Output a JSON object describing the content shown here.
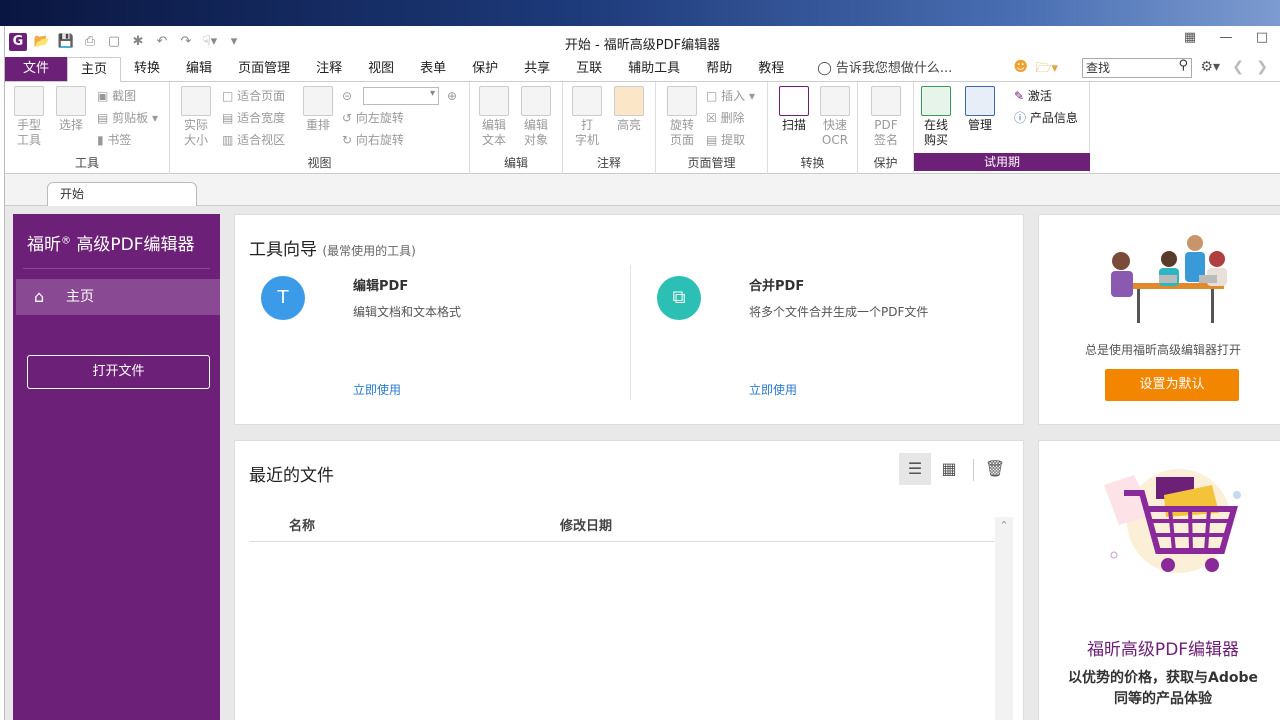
{
  "window": {
    "title": "开始 - 福昕高级PDF编辑器"
  },
  "menu_tabs": [
    "文件",
    "主页",
    "转换",
    "编辑",
    "页面管理",
    "注释",
    "视图",
    "表单",
    "保护",
    "共享",
    "互联",
    "辅助工具",
    "帮助",
    "教程"
  ],
  "tell_me": "告诉我您想做什么...",
  "search": {
    "placeholder": "查找"
  },
  "ribbon": {
    "tools": {
      "hand": "手型\n工具",
      "select": "选择",
      "snapshot": "截图",
      "clipboard": "剪贴板",
      "bookmark": "书签",
      "label": "工具"
    },
    "view": {
      "actual": "实际\n大小",
      "fit_page": "适合页面",
      "fit_width": "适合宽度",
      "fit_view": "适合视区",
      "reflow": "重排",
      "rotate_left": "向左旋转",
      "rotate_right": "向右旋转",
      "label": "视图"
    },
    "edit": {
      "edit_text": "编辑\n文本",
      "edit_object": "编辑\n对象",
      "label": "编辑"
    },
    "comment": {
      "typewriter": "打\n字机",
      "highlight": "高亮",
      "label": "注释"
    },
    "pages": {
      "rotate": "旋转\n页面",
      "insert": "插入",
      "delete": "删除",
      "extract": "提取",
      "label": "页面管理"
    },
    "convert": {
      "scan": "扫描",
      "ocr": "快速\nOCR",
      "label": "转换"
    },
    "protect": {
      "sign": "PDF\n签名",
      "label": "保护"
    },
    "trial": {
      "buy": "在线\n购买",
      "manage": "管理",
      "activate": "激活",
      "info": "产品信息",
      "label": "试用期"
    }
  },
  "doc_tab": "开始",
  "sidebar": {
    "brand": "福昕",
    "brand_reg": "®",
    "brand_rest": " 高级PDF编辑器",
    "home": "主页",
    "open_file": "打开文件"
  },
  "tools_card": {
    "title": "工具向导",
    "subtitle": "(最常使用的工具)",
    "items": [
      {
        "name": "编辑PDF",
        "desc": "编辑文档和文本格式",
        "link": "立即使用",
        "color": "#3b9be8"
      },
      {
        "name": "合并PDF",
        "desc": "将多个文件合并生成一个PDF文件",
        "link": "立即使用",
        "color": "#2cbfb4"
      }
    ]
  },
  "recent": {
    "title": "最近的文件",
    "col_name": "名称",
    "col_date": "修改日期"
  },
  "promo_top": {
    "text": "总是使用福昕高级编辑器打开",
    "button": "设置为默认"
  },
  "promo_bottom": {
    "title": "福昕高级PDF编辑器",
    "line1": "以优势的价格，获取与Adobe",
    "line2": "同等的产品体验"
  }
}
